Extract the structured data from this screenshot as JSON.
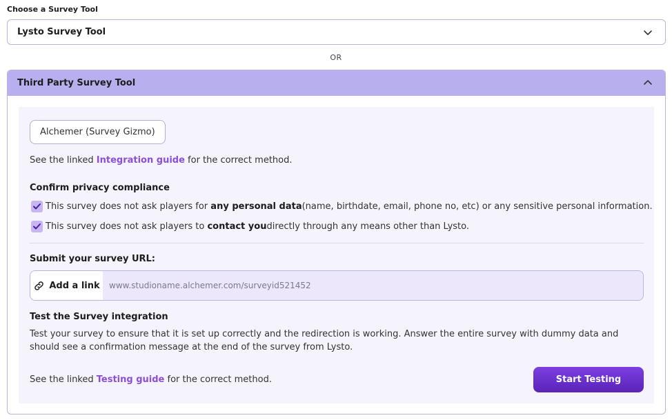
{
  "survey_tool": {
    "label": "Choose a Survey Tool",
    "selected": "Lysto Survey Tool"
  },
  "or_label": "OR",
  "third_party": {
    "title": "Third Party Survey Tool",
    "tool_chip": "Alchemer (Survey Gizmo)",
    "integration_prefix": "See the linked ",
    "integration_link": "Integration guide",
    "integration_suffix": " for the correct method.",
    "privacy_heading": "Confirm privacy compliance",
    "check1": {
      "prefix": "This survey does not ask players for ",
      "bold": "any personal data",
      "suffix": " (name, birthdate, email, phone no, etc) or any sensitive personal information.",
      "checked": true
    },
    "check2": {
      "prefix": "This survey does not ask players to ",
      "bold": "contact you",
      "suffix": " directly through any means other than Lysto.",
      "checked": true
    },
    "url_heading": "Submit your survey URL:",
    "add_link_label": "Add a link",
    "url_placeholder": "www.studioname.alchemer.com/surveyid521452",
    "test_heading": "Test the Survey integration",
    "test_desc": "Test your survey to ensure that it is set up correctly and the redirection is working. Answer the entire survey with dummy data and should see a confirmation message at the end of the survey from Lysto.",
    "testing_prefix": "See the linked ",
    "testing_link": "Testing guide",
    "testing_suffix": " for the correct method.",
    "start_button": "Start Testing"
  },
  "icons": {
    "select_chevron": "chevron-down-icon",
    "panel_chevron": "chevron-up-icon",
    "link": "link-icon",
    "check": "check-icon"
  },
  "colors": {
    "accent": "#8b4fd8",
    "panel_header": "#b8b0ee",
    "button": "#6a30cc",
    "checkbox": "#c8b6f3"
  }
}
